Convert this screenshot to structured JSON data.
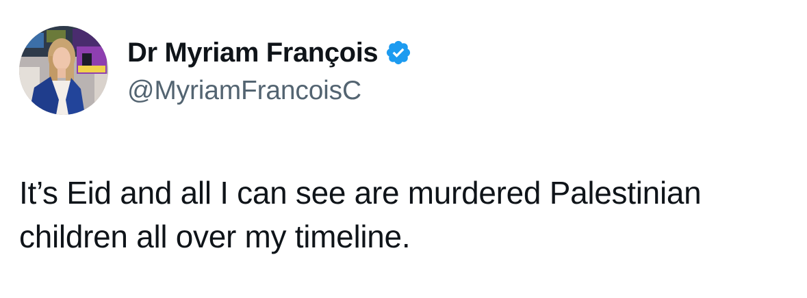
{
  "author": {
    "display_name": "Dr Myriam François",
    "handle": "@MyriamFrancoisC",
    "verified": true
  },
  "tweet": {
    "text_lines": [
      "It’s Eid and all I can see are murdered Palestinian",
      "children all over my timeline."
    ]
  },
  "icons": {
    "verified": "verified-badge-icon",
    "avatar": "profile-photo"
  },
  "colors": {
    "text_primary": "#0f1419",
    "text_secondary": "#536471",
    "verified_blue": "#1d9bf0",
    "background": "#ffffff"
  }
}
